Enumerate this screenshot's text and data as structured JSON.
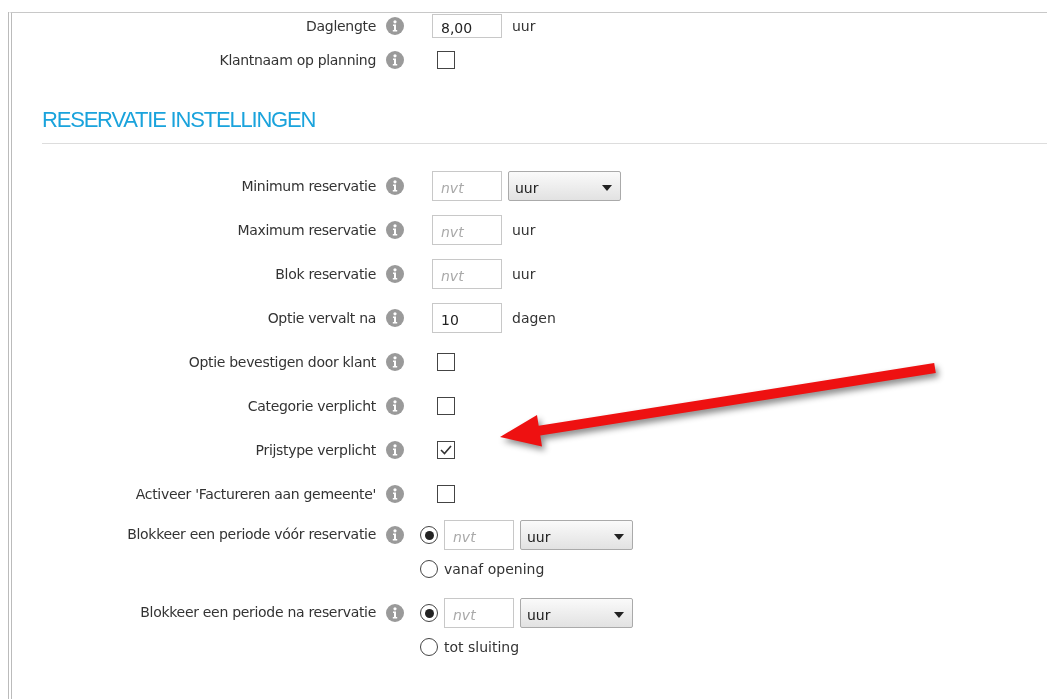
{
  "top_rows": [
    {
      "label": "Daglengte",
      "kind": "input",
      "value": "8,00",
      "unit": {
        "kind": "text",
        "text": "uur"
      }
    },
    {
      "label": "Klantnaam op planning",
      "kind": "checkbox",
      "checked": false
    }
  ],
  "section": {
    "title": "RESERVATIE INSTELLINGEN",
    "rows": [
      {
        "label": "Minimum reservatie",
        "kind": "input",
        "placeholder": "nvt",
        "unit": {
          "kind": "select",
          "text": "uur"
        }
      },
      {
        "label": "Maximum reservatie",
        "kind": "input",
        "placeholder": "nvt",
        "unit": {
          "kind": "text",
          "text": "uur"
        }
      },
      {
        "label": "Blok reservatie",
        "kind": "input",
        "placeholder": "nvt",
        "unit": {
          "kind": "text",
          "text": "uur"
        }
      },
      {
        "label": "Optie vervalt na",
        "kind": "input",
        "value": "10",
        "unit": {
          "kind": "text",
          "text": "dagen"
        }
      },
      {
        "label": "Optie bevestigen door klant",
        "kind": "checkbox",
        "checked": false
      },
      {
        "label": "Categorie verplicht",
        "kind": "checkbox",
        "checked": false
      },
      {
        "label": "Prijstype verplicht",
        "kind": "checkbox",
        "checked": true
      },
      {
        "label": "Activeer 'Factureren aan gemeente'",
        "kind": "checkbox",
        "checked": false
      },
      {
        "label": "Blokkeer een periode vóór reservatie",
        "kind": "period",
        "options": [
          {
            "selected": true,
            "placeholder": "nvt",
            "unit": "uur"
          },
          {
            "selected": false,
            "text": "vanaf opening"
          }
        ]
      },
      {
        "label": "Blokkeer een periode na reservatie",
        "kind": "period",
        "options": [
          {
            "selected": true,
            "placeholder": "nvt",
            "unit": "uur"
          },
          {
            "selected": false,
            "text": "tot sluiting"
          }
        ]
      }
    ]
  }
}
